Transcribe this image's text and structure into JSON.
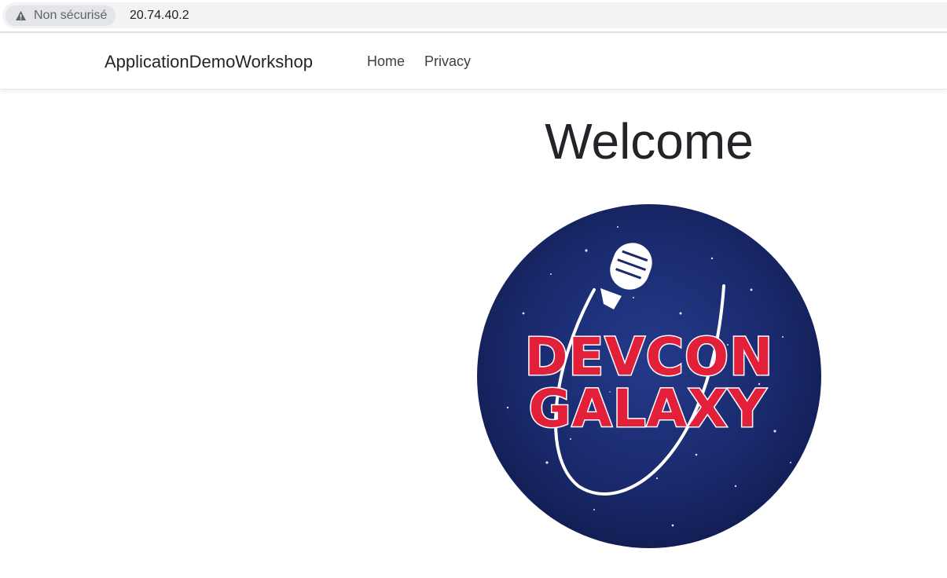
{
  "browser": {
    "security_label": "Non sécurisé",
    "url": "20.74.40.2",
    "security_icon": "warning-triangle-icon"
  },
  "navbar": {
    "brand": "ApplicationDemoWorkshop",
    "links": [
      {
        "label": "Home"
      },
      {
        "label": "Privacy"
      }
    ]
  },
  "main": {
    "heading": "Welcome",
    "logo": {
      "line1": "DEVCON",
      "line2": "GALAXY",
      "icon": "microphone-icon",
      "colors": {
        "background": "#1c2a6b",
        "text": "#e3203a"
      }
    }
  }
}
